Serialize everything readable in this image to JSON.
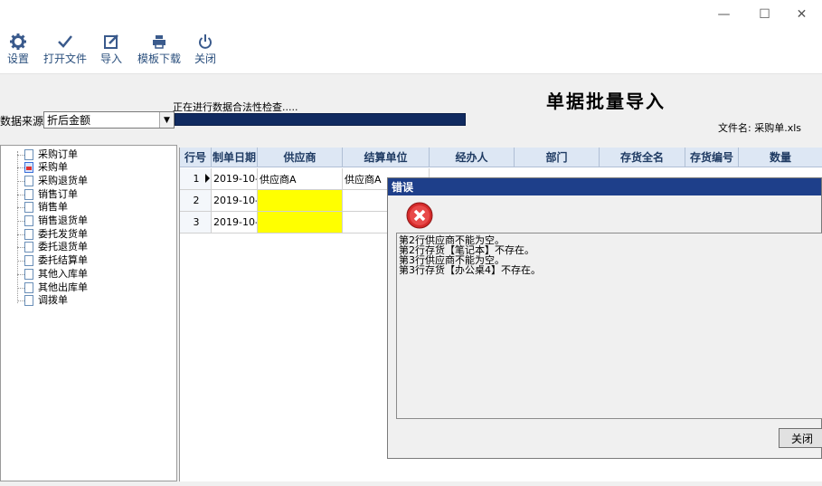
{
  "window": {
    "minimize": "—",
    "maximize": "☐",
    "close": "✕"
  },
  "toolbar": {
    "settings": "设置",
    "open_file": "打开文件",
    "import": "导入",
    "template_download": "模板下载",
    "close": "关闭"
  },
  "header": {
    "title": "单据批量导入",
    "checking": "正在进行数据合法性检查.....",
    "progress": 1.0,
    "data_source_label": "数据来源",
    "data_source_value": "折后金额",
    "filename": "文件名: 采购单.xls"
  },
  "tree": {
    "items": [
      "采购订单",
      "采购单",
      "采购退货单",
      "销售订单",
      "销售单",
      "销售退货单",
      "委托发货单",
      "委托退货单",
      "委托结算单",
      "其他入库单",
      "其他出库单",
      "调拨单"
    ],
    "selected": "采购单"
  },
  "grid": {
    "columns": [
      "行号",
      "制单日期",
      "供应商",
      "结算单位",
      "经办人",
      "部门",
      "存货全名",
      "存货编号",
      "数量"
    ],
    "rows": [
      {
        "n": "1",
        "date": "2019-10-",
        "supplier": "供应商A",
        "settle": "供应商A"
      },
      {
        "n": "2",
        "date": "2019-10-",
        "supplier": "",
        "settle": ""
      },
      {
        "n": "3",
        "date": "2019-10-",
        "supplier": "",
        "settle": ""
      }
    ],
    "highlight_color": "#ffff00"
  },
  "dialog": {
    "title": "错误",
    "messages": [
      "第2行供应商不能为空。",
      "第2行存货【笔记本】不存在。",
      "第3行供应商不能为空。",
      "第3行存货【办公桌4】不存在。"
    ],
    "close_button": "关闭"
  },
  "colors": {
    "dialog_title": "#1e3f8a",
    "progress": "#102a60",
    "grid_header": "#dde7f4",
    "error_icon": "#d52b2b"
  }
}
